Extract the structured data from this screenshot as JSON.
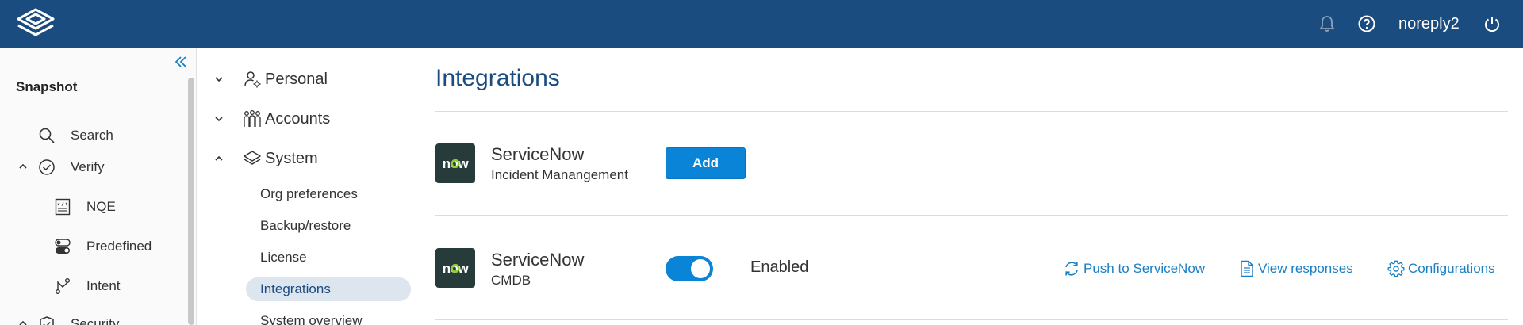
{
  "header": {
    "username": "noreply2",
    "icons": [
      "logo-icon",
      "bell-icon",
      "help-icon",
      "power-icon"
    ],
    "brand_color": "#1a4c80"
  },
  "sidebar": {
    "title": "Snapshot",
    "items": [
      {
        "label": "Search",
        "icon": "search-icon"
      },
      {
        "label": "Verify",
        "icon": "check-circle-icon",
        "expanded": true
      },
      {
        "label": "NQE",
        "icon": "code-doc-icon"
      },
      {
        "label": "Predefined",
        "icon": "toggles-icon"
      },
      {
        "label": "Intent",
        "icon": "path-icon"
      },
      {
        "label": "Security",
        "icon": "shield-icon",
        "expanded": true
      }
    ]
  },
  "nav": {
    "groups": [
      {
        "label": "Personal",
        "icon": "user-gear-icon",
        "expanded": false
      },
      {
        "label": "Accounts",
        "icon": "people-icon",
        "expanded": false
      },
      {
        "label": "System",
        "icon": "layers-icon",
        "expanded": true
      }
    ],
    "system_items": [
      "Org preferences",
      "Backup/restore",
      "License",
      "Integrations",
      "System overview"
    ],
    "active_item": "Integrations"
  },
  "main": {
    "title": "Integrations",
    "integrations": [
      {
        "name": "ServiceNow",
        "subtitle": "Incident Manangement",
        "logo_text": "now",
        "button_label": "Add"
      },
      {
        "name": "ServiceNow",
        "subtitle": "CMDB",
        "logo_text": "now",
        "toggle_on": true,
        "status_label": "Enabled",
        "actions": [
          {
            "label": "Push to ServiceNow",
            "icon": "refresh-icon"
          },
          {
            "label": "View responses",
            "icon": "document-icon"
          },
          {
            "label": "Configurations",
            "icon": "gear-icon"
          }
        ]
      }
    ]
  },
  "colors": {
    "accent": "#0a84d6",
    "link": "#1b7fc4",
    "logo_bg": "#263b3a",
    "logo_o": "#8fce2f"
  }
}
